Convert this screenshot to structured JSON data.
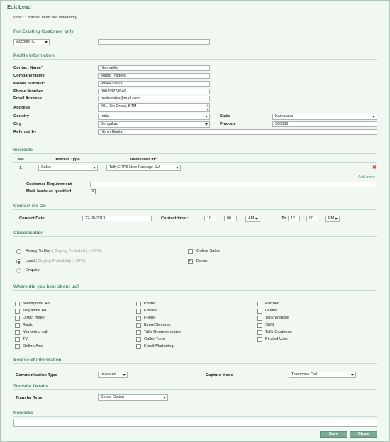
{
  "page": {
    "title": "Edit Lead",
    "note_prefix": "Note :",
    "note_star": "*",
    "note_suffix": "marked fields are mandatory"
  },
  "existing_customer": {
    "heading": "For Existing Customer only",
    "account_select": "Account ID",
    "account_value": ""
  },
  "profile": {
    "heading": "Profile Information",
    "contact_name_label": "Contact Name",
    "contact_name": "Neeharika",
    "company_label": "Company Name",
    "company": "Magic Traders",
    "mobile_label": "Mobile Number",
    "mobile": "9958475623",
    "phone_label": "Phone Number",
    "phone": "080-58274546",
    "email_label": "Email Address",
    "email": "neeharaika@mail.com",
    "address_label": "Address",
    "address": "#81, 3th Cross, BTM",
    "country_label": "Country",
    "country": "India",
    "state_label": "State",
    "state": "Karnataka",
    "city_label": "City",
    "city": "Bengaluru",
    "pincode_label": "Pincode",
    "pincode": "560086",
    "referred_label": "Referred by",
    "referred": "Nithin Gupta",
    "required_star": "*"
  },
  "interests": {
    "heading": "Interests",
    "col_no": "No.",
    "col_type": "Interest Type",
    "col_in": "Interested In",
    "row_no": "1.",
    "row_type": "Sales",
    "row_in": "Tally.ERP9 New Package SU",
    "remove_glyph": "✕",
    "add_more": "Add more",
    "requirement_label": "Customer Requirement",
    "requirement_value": "",
    "qualified_label": "Mark leads as qualified",
    "qualified_checked": true
  },
  "contact_me": {
    "heading": "Contact Me On",
    "date_label": "Contact Date",
    "date": "22-08-2013",
    "time_label": "Contact time :",
    "from_hour": "10",
    "from_min": "00",
    "from_ampm": "AM",
    "to_label": "To",
    "to_hour": "12",
    "to_min": "00",
    "to_ampm": "PM",
    "colon": ":"
  },
  "classification": {
    "heading": "Classification",
    "ready_label": "Ready To Buy",
    "ready_hint": "( Buying Probability > 90%)",
    "lead_label": "Lead",
    "lead_hint": "( Buying Probability > 50%)",
    "enquiry_label": "Enquiry",
    "online_sales_label": "Online Sales",
    "demo_label": "Demo",
    "selected": "lead",
    "online_sales_checked": false,
    "demo_checked": true
  },
  "hear_about": {
    "heading": "Where did you hear about us?",
    "col1": [
      {
        "label": "Newspaper Ad",
        "checked": false
      },
      {
        "label": "Magazine Ad",
        "checked": false
      },
      {
        "label": "Direct mailer",
        "checked": false
      },
      {
        "label": "Radio",
        "checked": false
      },
      {
        "label": "Marketing call",
        "checked": false
      },
      {
        "label": "TV",
        "checked": false
      },
      {
        "label": "Online Ads",
        "checked": false
      }
    ],
    "col2": [
      {
        "label": "Poster",
        "checked": false
      },
      {
        "label": "Emailer",
        "checked": false
      },
      {
        "label": "Friend",
        "checked": true
      },
      {
        "label": "Event/Seminar",
        "checked": false
      },
      {
        "label": "Tally Representative",
        "checked": false
      },
      {
        "label": "Caller Tune",
        "checked": false
      },
      {
        "label": "Email Marketing",
        "checked": false
      }
    ],
    "col3": [
      {
        "label": "Partner",
        "checked": false
      },
      {
        "label": "Leaflet",
        "checked": false
      },
      {
        "label": "Tally Website",
        "checked": false
      },
      {
        "label": "SMS",
        "checked": false
      },
      {
        "label": "Tally Customer",
        "checked": false
      },
      {
        "label": "Pirated User",
        "checked": false
      }
    ]
  },
  "source": {
    "heading": "Source of information",
    "comm_label": "Communication Type",
    "comm_value": "In-bound",
    "capture_label": "Capture Mode",
    "capture_value": "Telephone Call"
  },
  "transfer": {
    "heading": "Transfer Details",
    "type_label": "Transfer Type",
    "type_value": "Select Option"
  },
  "remarks": {
    "heading": "Remarks",
    "value": ""
  },
  "buttons": {
    "save": "Save",
    "close": "Close"
  },
  "colors": {
    "accent": "#4b8a70",
    "button": "#7aaa96",
    "background": "#f0f8f1",
    "required": "#dd0000"
  }
}
